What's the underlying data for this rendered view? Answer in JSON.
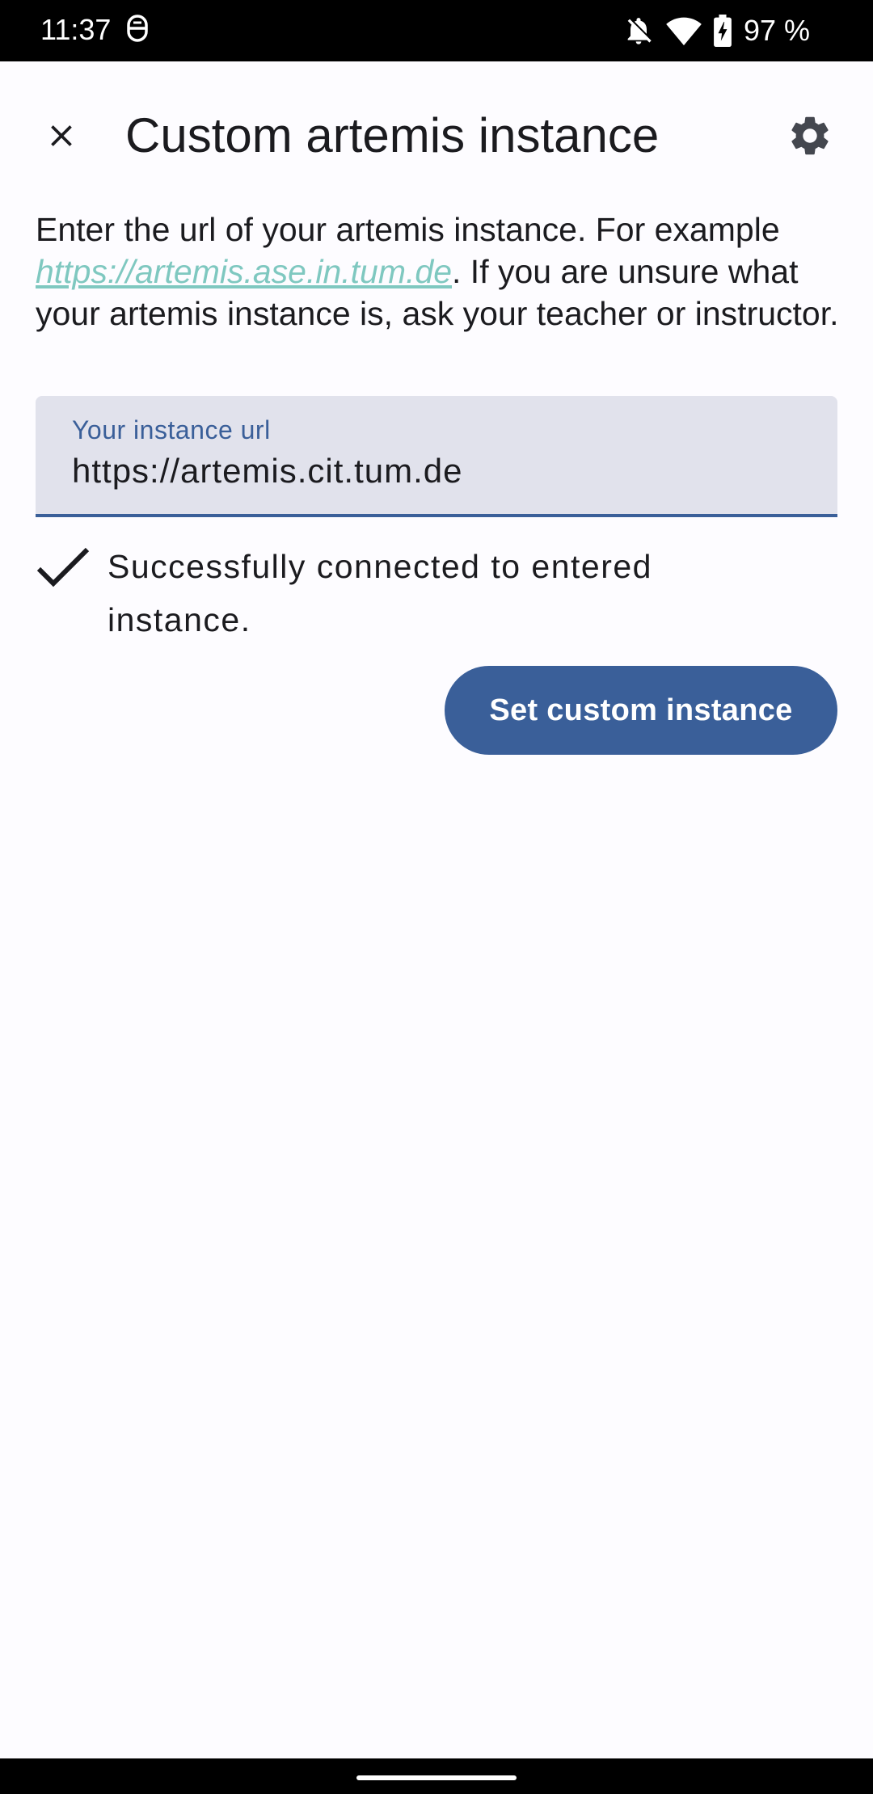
{
  "status_bar": {
    "time": "11:37",
    "battery_percent": "97 %",
    "icons": [
      "notification-app-icon",
      "bell-off-icon",
      "wifi-icon",
      "battery-charging-icon"
    ]
  },
  "app_bar": {
    "title": "Custom artemis instance",
    "close_icon": "close-icon",
    "settings_icon": "gear-icon"
  },
  "description": {
    "before_link": "Enter the url of your artemis instance. For example ",
    "link": "https://artemis.ase.in.tum.de",
    "after_link": ". If you are unsure what your artemis instance is, ask your teacher or instructor."
  },
  "instance_field": {
    "label": "Your instance url",
    "value": "https://artemis.cit.tum.de"
  },
  "connection_status": {
    "icon": "check-icon",
    "message": "Successfully connected to entered instance."
  },
  "actions": {
    "set_instance_label": "Set custom instance"
  },
  "colors": {
    "primary": "#3a5f99",
    "field_background": "#e1e2ec",
    "link": "#7fc8c0",
    "background": "#fdfcff"
  }
}
